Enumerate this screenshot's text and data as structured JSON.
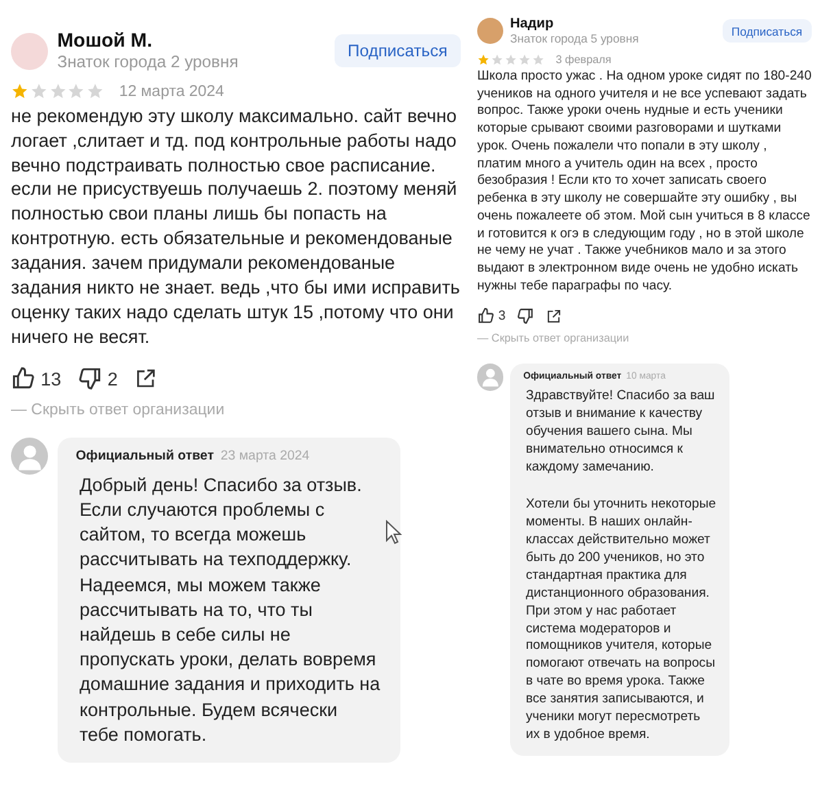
{
  "reviews": [
    {
      "author": "Мошой М.",
      "badge": "Знаток города 2 уровня",
      "subscribe": "Подписаться",
      "stars": 1,
      "date": "12 марта 2024",
      "text": "не рекомендую эту школу максимально. сайт вечно логает ,слитает и тд. под контрольные работы надо вечно подстраивать полностью свое расписание. если не присуствуешь получаешь 2. поэтому меняй полностью свои планы лишь бы попасть на контротную. есть обязательные и рекомендованые задания. зачем придумали рекомендованые задания никто не знает. ведь ,что бы ими исправить оценку таких надо сделать штук 15 ,потому что они ничего не весят.",
      "likes": "13",
      "dislikes": "2",
      "hide_reply": "— Скрыть ответ организации",
      "reply": {
        "title": "Официальный ответ",
        "date": "23 марта 2024",
        "paragraphs": [
          "Добрый день! Спасибо за отзыв. Если случаются проблемы с сайтом, то всегда можешь рассчитывать на техподдержку. Надеемся, мы можем также рассчитывать на то, что ты найдешь в себе силы не пропускать уроки, делать вовремя домашние задания и приходить на контрольные. Будем всячески тебе помогать."
        ]
      }
    },
    {
      "author": "Надир",
      "badge": "Знаток города 5 уровня",
      "subscribe": "Подписаться",
      "stars": 1,
      "date": "3 февраля",
      "text": "Школа просто ужас . На одном уроке сидят по 180-240 учеников на одного учителя и не все успевают задать вопрос. Также уроки очень нудные и есть ученики которые срывают своими разговорами и шутками урок. Очень пожалели что попали в эту школу , платим много а учитель один на всех , просто безобразия ! Если кто то хочет записать своего ребенка в эту школу не совершайте эту ошибку , вы очень пожалеете об этом. Мой сын учиться в 8 классе и готовится к огэ в следующим году , но в этой школе не чему не учат . Также учебников мало и за этого выдают в электронном виде очень не удобно искать нужны тебе параграфы по часу.",
      "likes": "3",
      "hide_reply": "— Скрыть ответ организации",
      "reply": {
        "title": "Официальный ответ",
        "date": "10 марта",
        "paragraphs": [
          "Здравствуйте! Спасибо за ваш отзыв и внимание к качеству обучения вашего сына. Мы внимательно относимся к каждому замечанию.",
          "Хотели бы уточнить некоторые моменты. В наших онлайн-классах действительно может быть до 200 учеников, но это стандартная практика для дистанционного образования. При этом у нас работает система модераторов и помощников учителя, которые помогают отвечать на вопросы в чате во время урока. Также все занятия записываются, и ученики могут пересмотреть их в удобное время."
        ]
      }
    }
  ]
}
